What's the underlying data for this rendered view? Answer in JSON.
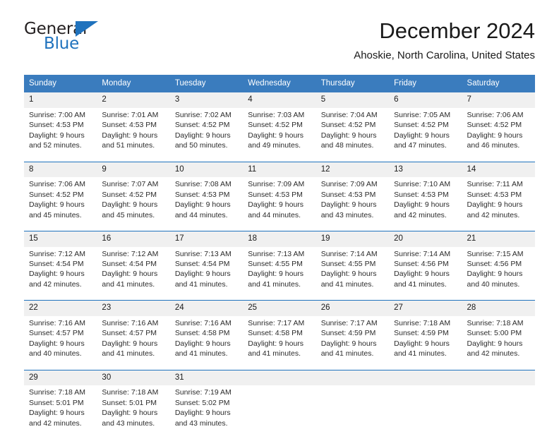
{
  "brand": {
    "name_part1": "General",
    "name_part2": "Blue",
    "triangle_color": "#1f72bd"
  },
  "header": {
    "month_title": "December 2024",
    "location": "Ahoskie, North Carolina, United States"
  },
  "calendar": {
    "header_color": "#3a7cbe",
    "row_border_color": "#1f72bd",
    "number_band_color": "#f0f0f0",
    "weekdays": [
      "Sunday",
      "Monday",
      "Tuesday",
      "Wednesday",
      "Thursday",
      "Friday",
      "Saturday"
    ],
    "weeks": [
      {
        "days": [
          {
            "num": "1",
            "sunrise": "Sunrise: 7:00 AM",
            "sunset": "Sunset: 4:53 PM",
            "daylight1": "Daylight: 9 hours",
            "daylight2": "and 52 minutes."
          },
          {
            "num": "2",
            "sunrise": "Sunrise: 7:01 AM",
            "sunset": "Sunset: 4:53 PM",
            "daylight1": "Daylight: 9 hours",
            "daylight2": "and 51 minutes."
          },
          {
            "num": "3",
            "sunrise": "Sunrise: 7:02 AM",
            "sunset": "Sunset: 4:52 PM",
            "daylight1": "Daylight: 9 hours",
            "daylight2": "and 50 minutes."
          },
          {
            "num": "4",
            "sunrise": "Sunrise: 7:03 AM",
            "sunset": "Sunset: 4:52 PM",
            "daylight1": "Daylight: 9 hours",
            "daylight2": "and 49 minutes."
          },
          {
            "num": "5",
            "sunrise": "Sunrise: 7:04 AM",
            "sunset": "Sunset: 4:52 PM",
            "daylight1": "Daylight: 9 hours",
            "daylight2": "and 48 minutes."
          },
          {
            "num": "6",
            "sunrise": "Sunrise: 7:05 AM",
            "sunset": "Sunset: 4:52 PM",
            "daylight1": "Daylight: 9 hours",
            "daylight2": "and 47 minutes."
          },
          {
            "num": "7",
            "sunrise": "Sunrise: 7:06 AM",
            "sunset": "Sunset: 4:52 PM",
            "daylight1": "Daylight: 9 hours",
            "daylight2": "and 46 minutes."
          }
        ]
      },
      {
        "days": [
          {
            "num": "8",
            "sunrise": "Sunrise: 7:06 AM",
            "sunset": "Sunset: 4:52 PM",
            "daylight1": "Daylight: 9 hours",
            "daylight2": "and 45 minutes."
          },
          {
            "num": "9",
            "sunrise": "Sunrise: 7:07 AM",
            "sunset": "Sunset: 4:52 PM",
            "daylight1": "Daylight: 9 hours",
            "daylight2": "and 45 minutes."
          },
          {
            "num": "10",
            "sunrise": "Sunrise: 7:08 AM",
            "sunset": "Sunset: 4:53 PM",
            "daylight1": "Daylight: 9 hours",
            "daylight2": "and 44 minutes."
          },
          {
            "num": "11",
            "sunrise": "Sunrise: 7:09 AM",
            "sunset": "Sunset: 4:53 PM",
            "daylight1": "Daylight: 9 hours",
            "daylight2": "and 44 minutes."
          },
          {
            "num": "12",
            "sunrise": "Sunrise: 7:09 AM",
            "sunset": "Sunset: 4:53 PM",
            "daylight1": "Daylight: 9 hours",
            "daylight2": "and 43 minutes."
          },
          {
            "num": "13",
            "sunrise": "Sunrise: 7:10 AM",
            "sunset": "Sunset: 4:53 PM",
            "daylight1": "Daylight: 9 hours",
            "daylight2": "and 42 minutes."
          },
          {
            "num": "14",
            "sunrise": "Sunrise: 7:11 AM",
            "sunset": "Sunset: 4:53 PM",
            "daylight1": "Daylight: 9 hours",
            "daylight2": "and 42 minutes."
          }
        ]
      },
      {
        "days": [
          {
            "num": "15",
            "sunrise": "Sunrise: 7:12 AM",
            "sunset": "Sunset: 4:54 PM",
            "daylight1": "Daylight: 9 hours",
            "daylight2": "and 42 minutes."
          },
          {
            "num": "16",
            "sunrise": "Sunrise: 7:12 AM",
            "sunset": "Sunset: 4:54 PM",
            "daylight1": "Daylight: 9 hours",
            "daylight2": "and 41 minutes."
          },
          {
            "num": "17",
            "sunrise": "Sunrise: 7:13 AM",
            "sunset": "Sunset: 4:54 PM",
            "daylight1": "Daylight: 9 hours",
            "daylight2": "and 41 minutes."
          },
          {
            "num": "18",
            "sunrise": "Sunrise: 7:13 AM",
            "sunset": "Sunset: 4:55 PM",
            "daylight1": "Daylight: 9 hours",
            "daylight2": "and 41 minutes."
          },
          {
            "num": "19",
            "sunrise": "Sunrise: 7:14 AM",
            "sunset": "Sunset: 4:55 PM",
            "daylight1": "Daylight: 9 hours",
            "daylight2": "and 41 minutes."
          },
          {
            "num": "20",
            "sunrise": "Sunrise: 7:14 AM",
            "sunset": "Sunset: 4:56 PM",
            "daylight1": "Daylight: 9 hours",
            "daylight2": "and 41 minutes."
          },
          {
            "num": "21",
            "sunrise": "Sunrise: 7:15 AM",
            "sunset": "Sunset: 4:56 PM",
            "daylight1": "Daylight: 9 hours",
            "daylight2": "and 40 minutes."
          }
        ]
      },
      {
        "days": [
          {
            "num": "22",
            "sunrise": "Sunrise: 7:16 AM",
            "sunset": "Sunset: 4:57 PM",
            "daylight1": "Daylight: 9 hours",
            "daylight2": "and 40 minutes."
          },
          {
            "num": "23",
            "sunrise": "Sunrise: 7:16 AM",
            "sunset": "Sunset: 4:57 PM",
            "daylight1": "Daylight: 9 hours",
            "daylight2": "and 41 minutes."
          },
          {
            "num": "24",
            "sunrise": "Sunrise: 7:16 AM",
            "sunset": "Sunset: 4:58 PM",
            "daylight1": "Daylight: 9 hours",
            "daylight2": "and 41 minutes."
          },
          {
            "num": "25",
            "sunrise": "Sunrise: 7:17 AM",
            "sunset": "Sunset: 4:58 PM",
            "daylight1": "Daylight: 9 hours",
            "daylight2": "and 41 minutes."
          },
          {
            "num": "26",
            "sunrise": "Sunrise: 7:17 AM",
            "sunset": "Sunset: 4:59 PM",
            "daylight1": "Daylight: 9 hours",
            "daylight2": "and 41 minutes."
          },
          {
            "num": "27",
            "sunrise": "Sunrise: 7:18 AM",
            "sunset": "Sunset: 4:59 PM",
            "daylight1": "Daylight: 9 hours",
            "daylight2": "and 41 minutes."
          },
          {
            "num": "28",
            "sunrise": "Sunrise: 7:18 AM",
            "sunset": "Sunset: 5:00 PM",
            "daylight1": "Daylight: 9 hours",
            "daylight2": "and 42 minutes."
          }
        ]
      },
      {
        "days": [
          {
            "num": "29",
            "sunrise": "Sunrise: 7:18 AM",
            "sunset": "Sunset: 5:01 PM",
            "daylight1": "Daylight: 9 hours",
            "daylight2": "and 42 minutes."
          },
          {
            "num": "30",
            "sunrise": "Sunrise: 7:18 AM",
            "sunset": "Sunset: 5:01 PM",
            "daylight1": "Daylight: 9 hours",
            "daylight2": "and 43 minutes."
          },
          {
            "num": "31",
            "sunrise": "Sunrise: 7:19 AM",
            "sunset": "Sunset: 5:02 PM",
            "daylight1": "Daylight: 9 hours",
            "daylight2": "and 43 minutes."
          },
          {
            "num": "",
            "sunrise": "",
            "sunset": "",
            "daylight1": "",
            "daylight2": ""
          },
          {
            "num": "",
            "sunrise": "",
            "sunset": "",
            "daylight1": "",
            "daylight2": ""
          },
          {
            "num": "",
            "sunrise": "",
            "sunset": "",
            "daylight1": "",
            "daylight2": ""
          },
          {
            "num": "",
            "sunrise": "",
            "sunset": "",
            "daylight1": "",
            "daylight2": ""
          }
        ]
      }
    ]
  }
}
